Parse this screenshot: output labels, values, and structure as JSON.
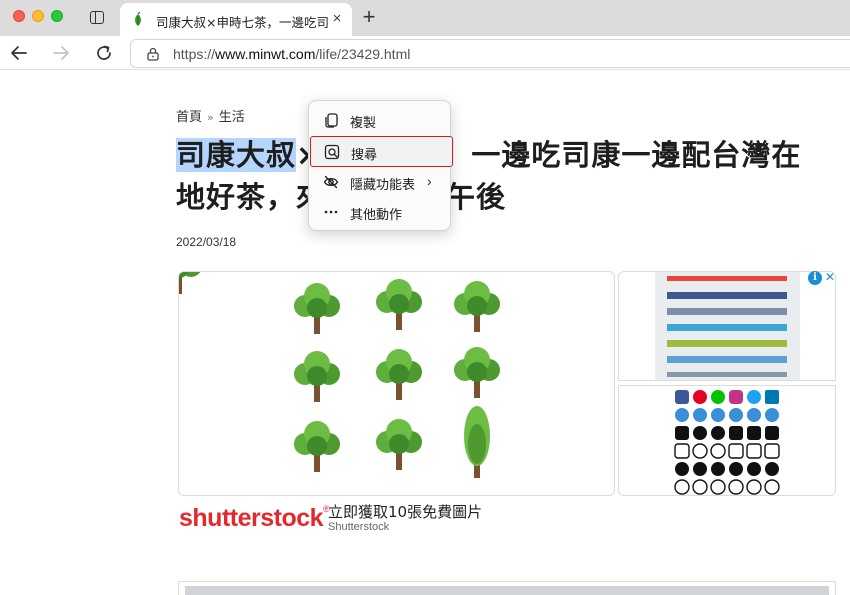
{
  "browser": {
    "tab": {
      "title": "司康大叔×申時七茶，一邊吃司康一邊配台灣在地好茶",
      "close_icon": "×"
    },
    "new_tab_icon": "+",
    "url": {
      "prefix": "https://",
      "domain": "www.minwt.com",
      "path": "/life/23429.html"
    }
  },
  "page": {
    "breadcrumb": {
      "home": "首頁",
      "separator": "»",
      "category": "生活"
    },
    "title_highlighted": "司康大叔",
    "title_rest_line1": "×申時七茶，一邊吃司康一邊配台灣在",
    "title_line2": "地好茶，來個漫步的午後",
    "date": "2022/03/18"
  },
  "ad": {
    "logo": "shutterstock",
    "logo_mark": "®",
    "headline": "立即獲取10張免費圖片",
    "advertiser": "Shutterstock",
    "info_icon": "i",
    "close_icon": "✕",
    "brand_color": "#e4292b"
  },
  "context_menu": {
    "items": [
      {
        "label": "複製",
        "icon": "copy-icon"
      },
      {
        "label": "搜尋",
        "icon": "search-icon"
      },
      {
        "label": "隱藏功能表",
        "icon": "hide-icon",
        "submenu": "›"
      },
      {
        "label": "其他動作",
        "icon": "more-icon"
      }
    ],
    "highlight_color": "#d41c1c"
  },
  "colors": {
    "selection": "#b4d5fe",
    "tab_bar": "#dcdcdc"
  }
}
